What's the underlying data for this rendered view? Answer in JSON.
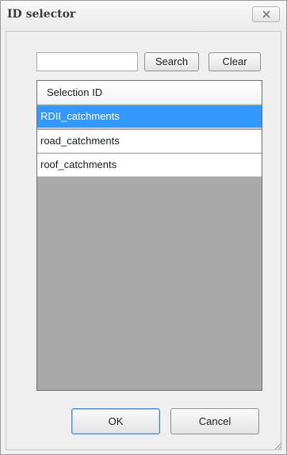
{
  "window": {
    "title": "ID selector",
    "close_icon": "close-icon"
  },
  "search": {
    "value": "",
    "search_label": "Search",
    "clear_label": "Clear"
  },
  "list": {
    "header": "Selection ID",
    "items": [
      {
        "label": "RDII_catchments",
        "selected": true
      },
      {
        "label": "road_catchments",
        "selected": false
      },
      {
        "label": "roof_catchments",
        "selected": false
      }
    ]
  },
  "footer": {
    "ok_label": "OK",
    "cancel_label": "Cancel"
  },
  "colors": {
    "selection": "#3399ff",
    "list_background": "#a9a9a9"
  }
}
